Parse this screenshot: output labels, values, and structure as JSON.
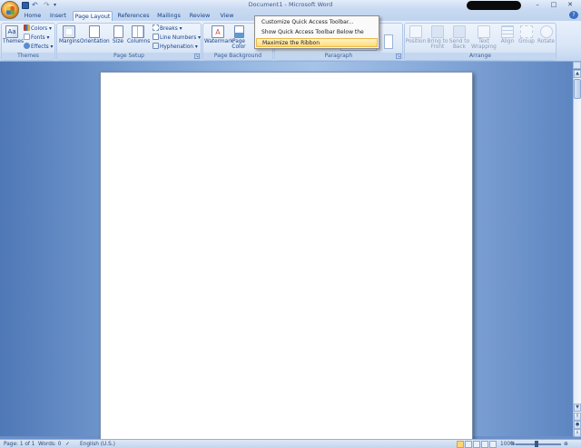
{
  "window": {
    "title": "Document1 - Microsoft Word",
    "controls": [
      "–",
      "□",
      "✕"
    ]
  },
  "quick_access": {
    "icons": [
      "save-icon",
      "undo-icon",
      "redo-icon",
      "customize-dropdown-icon"
    ]
  },
  "tabs": [
    "Home",
    "Insert",
    "Page Layout",
    "References",
    "Mailings",
    "Review",
    "View"
  ],
  "active_tab": "Page Layout",
  "ribbon": {
    "themes": {
      "label": "Themes",
      "themes_button": "Themes",
      "colors": "Colors",
      "fonts": "Fonts",
      "effects": "Effects"
    },
    "page_setup": {
      "label": "Page Setup",
      "margins": "Margins",
      "orientation": "Orientation",
      "size": "Size",
      "columns": "Columns",
      "breaks": "Breaks",
      "line_numbers": "Line Numbers",
      "hyphenation": "Hyphenation"
    },
    "page_background": {
      "label": "Page Background",
      "watermark": "Watermark",
      "page_color_line1": "Page",
      "page_color_line2": "Color"
    },
    "paragraph": {
      "label": "Paragraph"
    },
    "arrange": {
      "label": "Arrange",
      "position": "Position",
      "bring_to_front_1": "Bring to",
      "bring_to_front_2": "Front",
      "send_to_back_1": "Send to",
      "send_to_back_2": "Back",
      "text_wrapping_1": "Text",
      "text_wrapping_2": "Wrapping",
      "align": "Align",
      "group": "Group",
      "rotate": "Rotate"
    }
  },
  "context_menu": {
    "items": [
      "Customize Quick Access Toolbar...",
      "Show Quick Access Toolbar Below the Ribbon",
      "Maximize the Ribbon"
    ],
    "highlighted_index": 2
  },
  "status_bar": {
    "page": "Page: 1 of 1",
    "words": "Words: 0",
    "language": "English (U.S.)",
    "zoom": "100%"
  },
  "colors": {
    "ribbon_bg": "#dde8f7",
    "tab_text": "#15428b",
    "menu_highlight": "#ffd97a",
    "workspace": "#7aa0d3"
  }
}
